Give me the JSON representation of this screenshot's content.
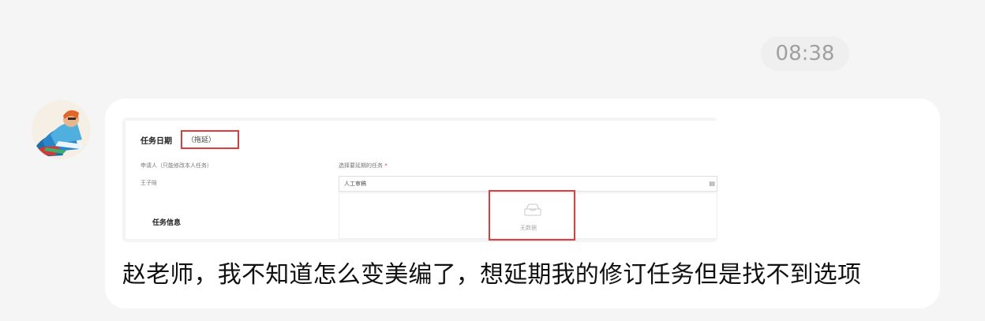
{
  "chat": {
    "timestamp": "08:38",
    "message": {
      "text": "赵老师，我不知道怎么变美编了，想延期我的修订任务但是找不到选项",
      "attachment": {
        "section_title": "任务日期",
        "highlighted_label": "（拖延）",
        "applicant_label": "申请人（只能修改本人任务）",
        "applicant_value": "王子晗",
        "select_task_label": "选择要延期的任务",
        "required_mark": "*",
        "select_value": "人工审稿",
        "dropdown_empty_text": "无数据",
        "task_info_title": "任务信息"
      }
    }
  }
}
